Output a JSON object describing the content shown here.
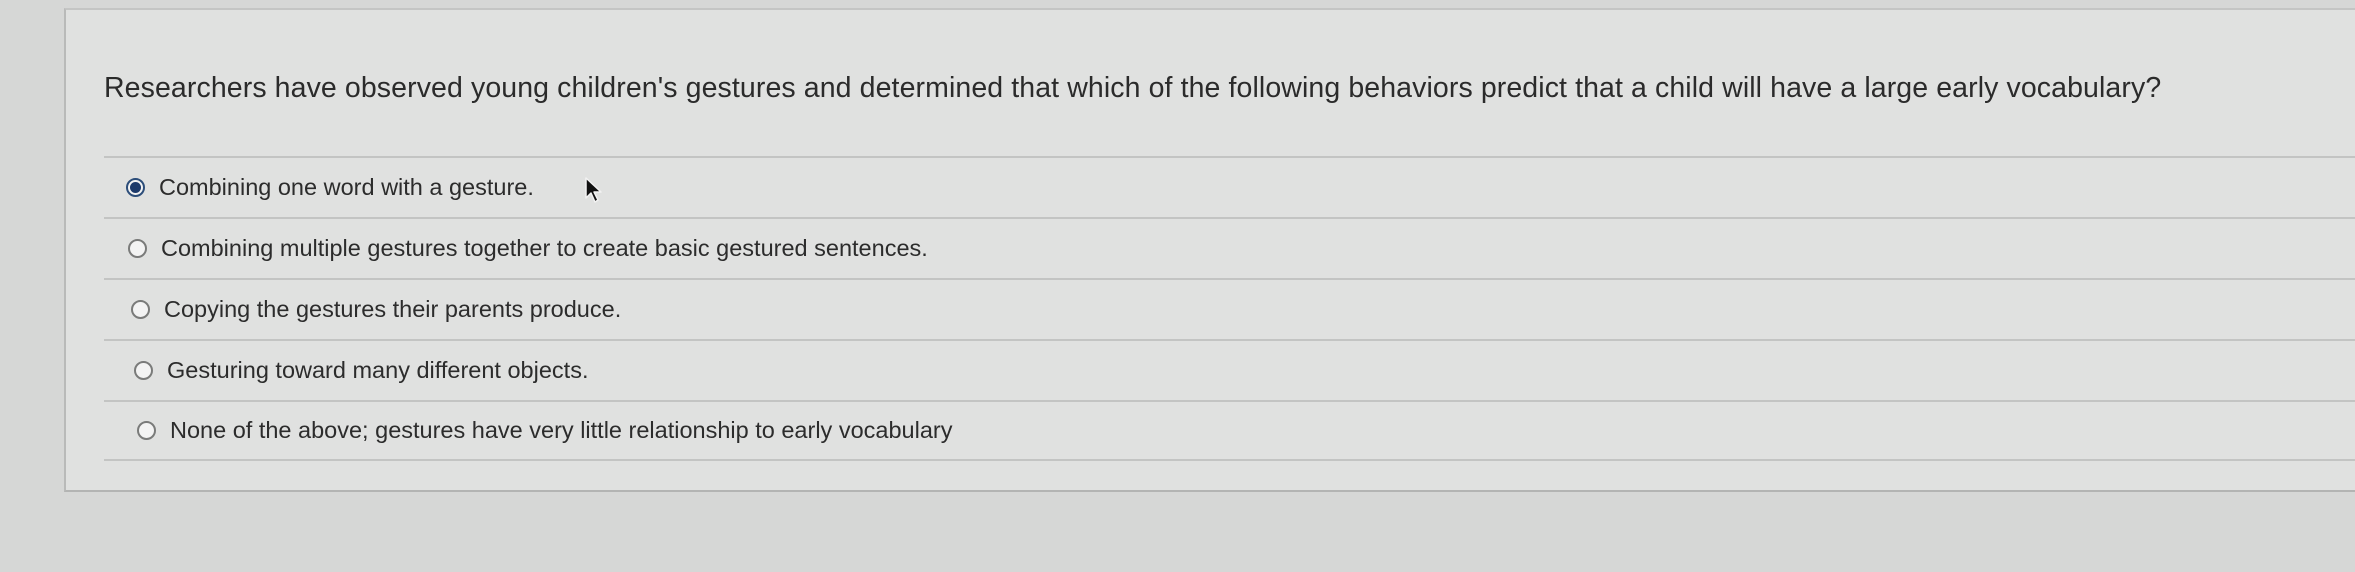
{
  "question": {
    "text": "Researchers have observed young children's gestures and determined that which of the following behaviors predict that a child will have a large early vocabulary?"
  },
  "answers": [
    {
      "label": "Combining one word with a gesture.",
      "selected": true
    },
    {
      "label": "Combining multiple gestures together to create basic gestured sentences.",
      "selected": false
    },
    {
      "label": "Copying the gestures their parents produce.",
      "selected": false
    },
    {
      "label": "Gesturing toward many different objects.",
      "selected": false
    },
    {
      "label": "None of the above; gestures have very little relationship to early vocabulary",
      "selected": false
    }
  ],
  "icons": {
    "cursor": "mouse-pointer-icon",
    "radio_selected": "radio-selected-icon",
    "radio_unselected": "radio-unselected-icon"
  },
  "colors": {
    "background": "#d6d7d6",
    "card": "#e0e1e0",
    "selected_radio": "#1d3a6b",
    "text": "#2b2b2b"
  }
}
